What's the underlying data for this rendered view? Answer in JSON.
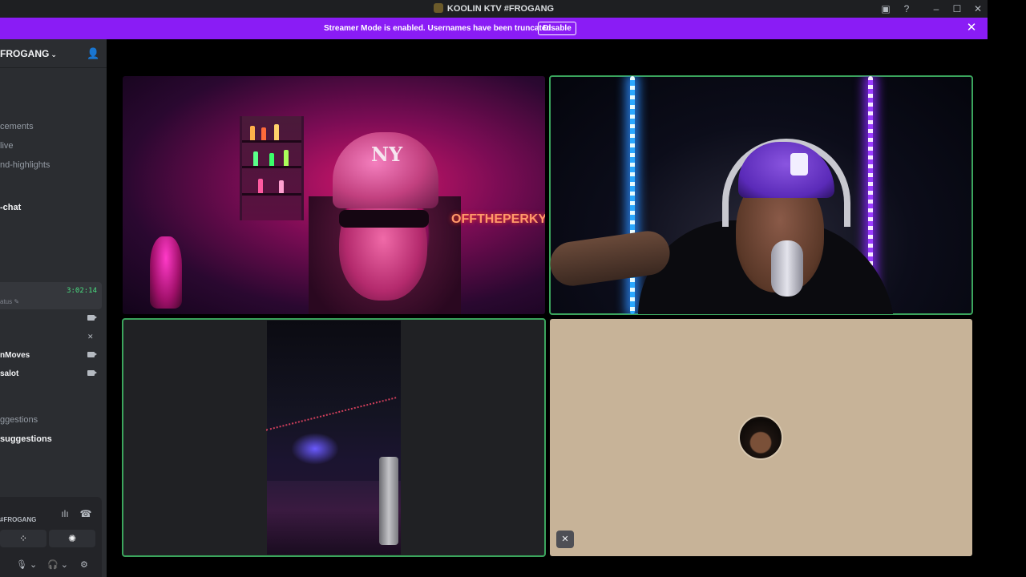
{
  "window": {
    "title": "KOOLIN KTV #FROGANG"
  },
  "banner": {
    "message": "Streamer Mode is enabled. Usernames have been truncated.",
    "disable_label": "Disable",
    "accent_color": "#8a1cf5"
  },
  "sidebar": {
    "server_name": "FROGANG",
    "channels": [
      {
        "label": "cements"
      },
      {
        "label": "live"
      },
      {
        "label": "nd-highlights"
      },
      {
        "label": "-chat"
      }
    ],
    "voice_timer": "3:02:14",
    "voice_status": "atus",
    "users": [
      {
        "name": "nMoves"
      },
      {
        "name": "salot"
      }
    ],
    "suggestions": [
      {
        "label": "ggestions"
      },
      {
        "label": "suggestions"
      }
    ],
    "voice_panel": {
      "channel_name": "#FROGANG"
    }
  },
  "video": {
    "tile1_neon": "OFFTHEPERKY",
    "tile1_cap_logo": "NY",
    "speaking_color": "#3ba55d"
  },
  "icons": {
    "titlebar": [
      "screen-share-icon",
      "help-icon",
      "minimize-icon",
      "maximize-icon",
      "close-icon"
    ],
    "voice_panel": [
      "soundboard-icon",
      "disconnect-icon",
      "activities-icon",
      "effects-icon"
    ],
    "user_bar": [
      "microphone-icon",
      "headphones-icon",
      "settings-icon"
    ]
  }
}
